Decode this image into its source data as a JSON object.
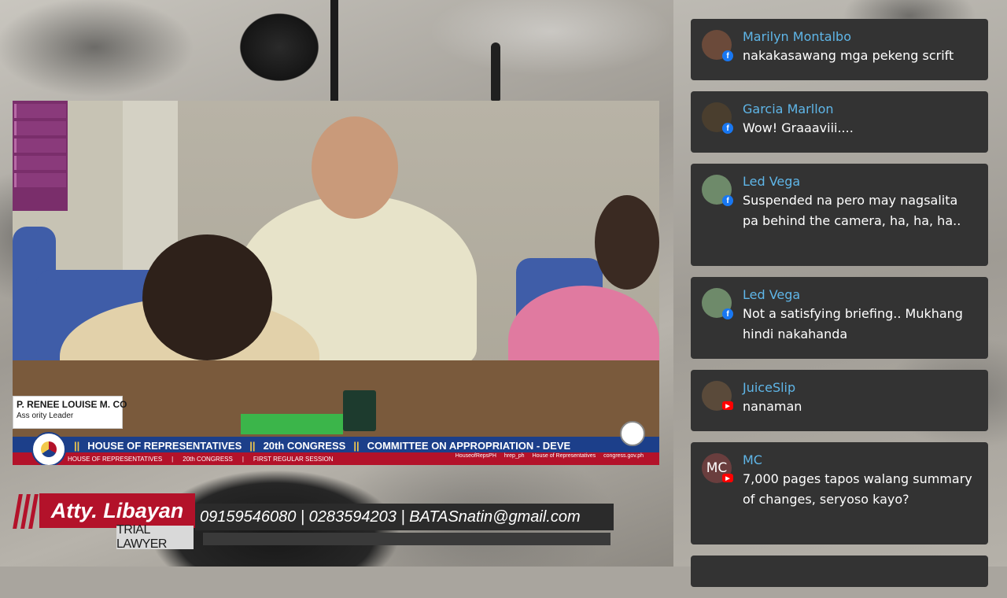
{
  "stream": {
    "video": {
      "lower_third": {
        "line1_parts": [
          "||",
          "HOUSE OF REPRESENTATIVES",
          "||",
          "20th CONGRESS",
          "||",
          "COMMITTEE ON APPROPRIATION - DEVE"
        ],
        "line2_parts": [
          "HOUSE OF REPRESENTATIVES",
          "|",
          "20th CONGRESS",
          "|",
          "FIRST REGULAR SESSION"
        ],
        "links": [
          "HouseofRepsPH",
          "hrep_ph",
          "House of Representatives",
          "congress.gov.ph"
        ]
      },
      "nameplate": {
        "name": "P. RENEE LOUISE M. CO",
        "role": "Ass    ority Leader"
      }
    },
    "banner": {
      "name": "Atty. Libayan",
      "title": "TRIAL LAWYER",
      "contact": "09159546080 | 0283594203 | BATASnatin@gmail.com"
    }
  },
  "chat": {
    "messages": [
      {
        "author": "Marilyn Montalbo",
        "text": "nakakasawang mga pekeng scrift",
        "platform": "facebook",
        "avatar_color": "#6b4a3a"
      },
      {
        "author": "Garcia Marllon",
        "text": "Wow! Graaaviii....",
        "platform": "facebook",
        "avatar_color": "#4a3e2e"
      },
      {
        "author": "Led Vega",
        "text": "Suspended na pero may nagsalita pa behind the camera, ha, ha, ha..",
        "platform": "facebook",
        "avatar_color": "#6e8a6a"
      },
      {
        "author": "Led Vega",
        "text": "Not a satisfying briefing.. Mukhang hindi nakahanda",
        "platform": "facebook",
        "avatar_color": "#6e8a6a"
      },
      {
        "author": "JuiceSlip",
        "text": "nanaman",
        "platform": "youtube",
        "avatar_color": "#5a4a3a"
      },
      {
        "author": "MC",
        "text": "7,000 pages tapos walang summary of changes, seryoso kayo?",
        "platform": "youtube",
        "avatar_color": "#6a3e3e",
        "avatar_text": "MC"
      }
    ]
  }
}
